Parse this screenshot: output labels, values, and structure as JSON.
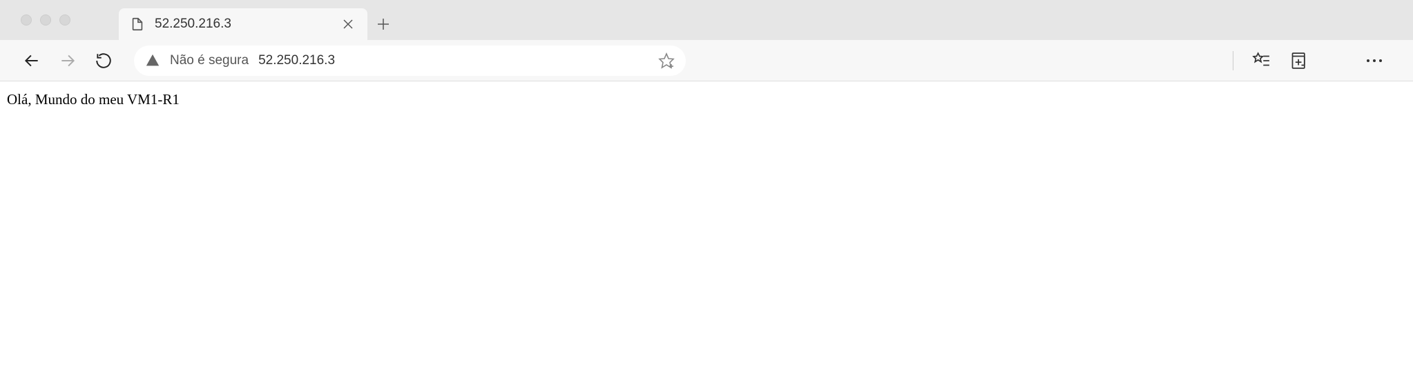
{
  "window": {
    "tab_title": "52.250.216.3"
  },
  "toolbar": {
    "security_label": "Não é segura",
    "url": "52.250.216.3"
  },
  "page": {
    "body_text": "Olá, Mundo do meu VM1-R1"
  }
}
